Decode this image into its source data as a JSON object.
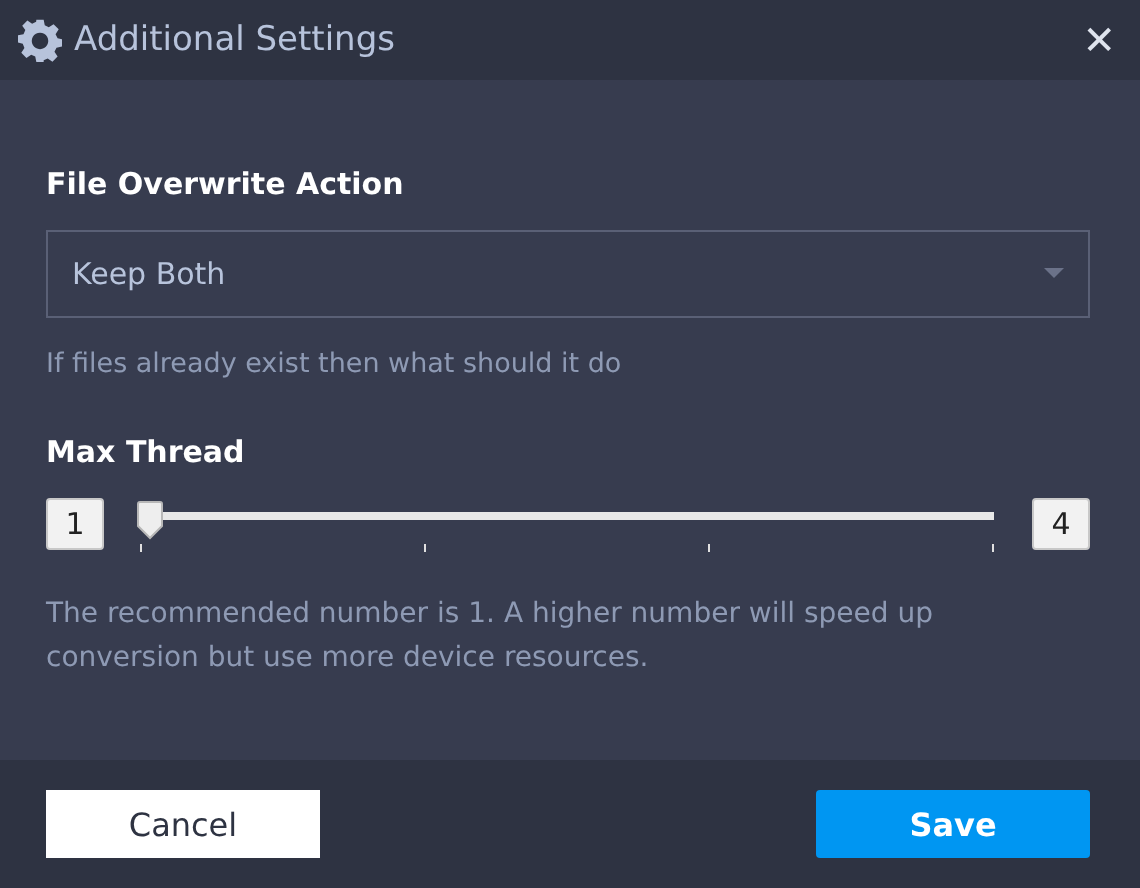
{
  "window": {
    "title": "Additional Settings",
    "close": "✕"
  },
  "overwrite": {
    "label": "File Overwrite Action",
    "value": "Keep Both",
    "hint": "If files already exist then what should it do"
  },
  "thread": {
    "label": "Max Thread",
    "min": "1",
    "max": "4",
    "level": 0,
    "description": "The recommended number is 1. A higher number will speed up conversion but use more device resources."
  },
  "buttons": [
    {
      "label": "Cancel",
      "kind": "secondary"
    },
    {
      "label": "Save",
      "kind": "primary"
    }
  ]
}
